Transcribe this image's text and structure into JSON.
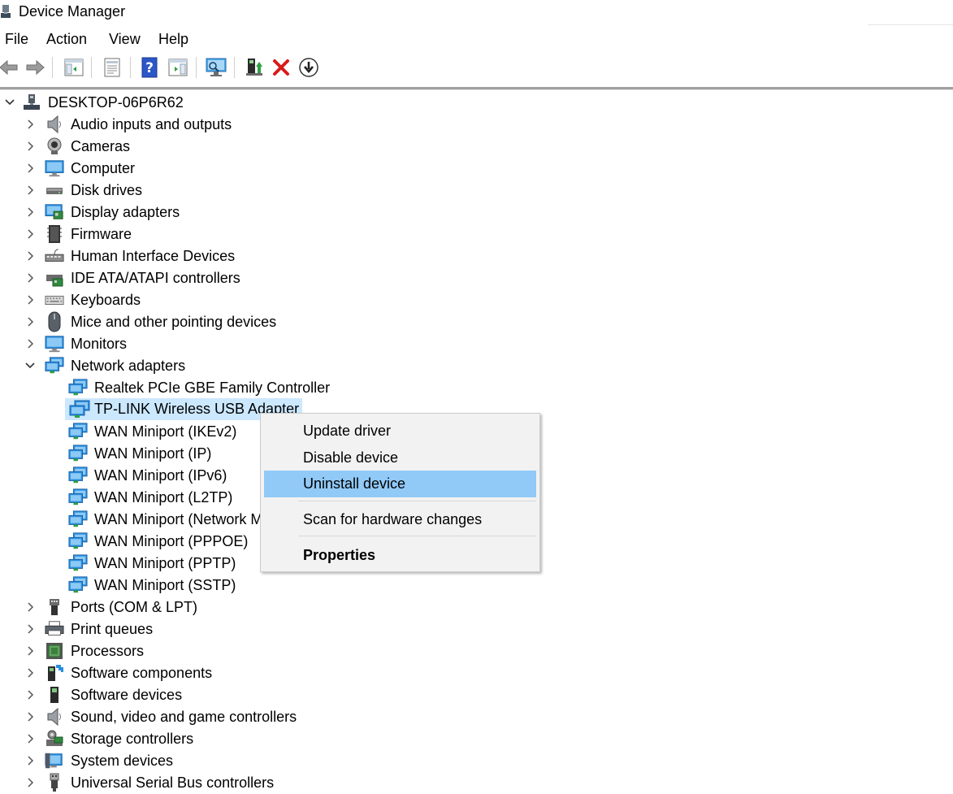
{
  "window": {
    "title": "Device Manager"
  },
  "menu": [
    "File",
    "Action",
    "View",
    "Help"
  ],
  "toolbar": [
    "back-icon",
    "forward-icon",
    "show-hide-console-tree-icon",
    "properties-icon",
    "help-icon",
    "action-pane-icon",
    "scan-hardware-icon",
    "update-driver-icon",
    "uninstall-device-icon",
    "disable-device-icon"
  ],
  "tree": {
    "root": "DESKTOP-06P6R62",
    "categories": [
      {
        "label": "Audio inputs and outputs",
        "icon": "speaker-icon"
      },
      {
        "label": "Cameras",
        "icon": "camera-icon"
      },
      {
        "label": "Computer",
        "icon": "computer-icon"
      },
      {
        "label": "Disk drives",
        "icon": "disk-drive-icon"
      },
      {
        "label": "Display adapters",
        "icon": "display-adapter-icon"
      },
      {
        "label": "Firmware",
        "icon": "firmware-icon"
      },
      {
        "label": "Human Interface Devices",
        "icon": "hid-icon"
      },
      {
        "label": "IDE ATA/ATAPI controllers",
        "icon": "ide-controller-icon"
      },
      {
        "label": "Keyboards",
        "icon": "keyboard-icon"
      },
      {
        "label": "Mice and other pointing devices",
        "icon": "mouse-icon"
      },
      {
        "label": "Monitors",
        "icon": "monitor-icon"
      },
      {
        "label": "Network adapters",
        "icon": "network-adapter-icon"
      }
    ],
    "network_children": [
      "Realtek PCIe GBE Family Controller",
      "TP-LINK Wireless USB Adapter",
      "WAN Miniport (IKEv2)",
      "WAN Miniport (IP)",
      "WAN Miniport (IPv6)",
      "WAN Miniport (L2TP)",
      "WAN Miniport (Network Monitor)",
      "WAN Miniport (PPPOE)",
      "WAN Miniport (PPTP)",
      "WAN Miniport (SSTP)"
    ],
    "after": [
      {
        "label": "Ports (COM & LPT)",
        "icon": "port-icon"
      },
      {
        "label": "Print queues",
        "icon": "printer-icon"
      },
      {
        "label": "Processors",
        "icon": "processor-icon"
      },
      {
        "label": "Software components",
        "icon": "software-component-icon"
      },
      {
        "label": "Software devices",
        "icon": "software-device-icon"
      },
      {
        "label": "Sound, video and game controllers",
        "icon": "speaker-icon"
      },
      {
        "label": "Storage controllers",
        "icon": "storage-controller-icon"
      },
      {
        "label": "System devices",
        "icon": "system-device-icon"
      },
      {
        "label": "Universal Serial Bus controllers",
        "icon": "usb-icon"
      }
    ]
  },
  "context_menu": {
    "items": [
      "Update driver",
      "Disable device",
      "Uninstall device",
      "Scan for hardware changes",
      "Properties"
    ],
    "highlighted": "Uninstall device"
  },
  "colors": {
    "selection": "#cce8ff",
    "menu_hover": "#91c9f7",
    "menu_bg": "#f2f2f2"
  }
}
